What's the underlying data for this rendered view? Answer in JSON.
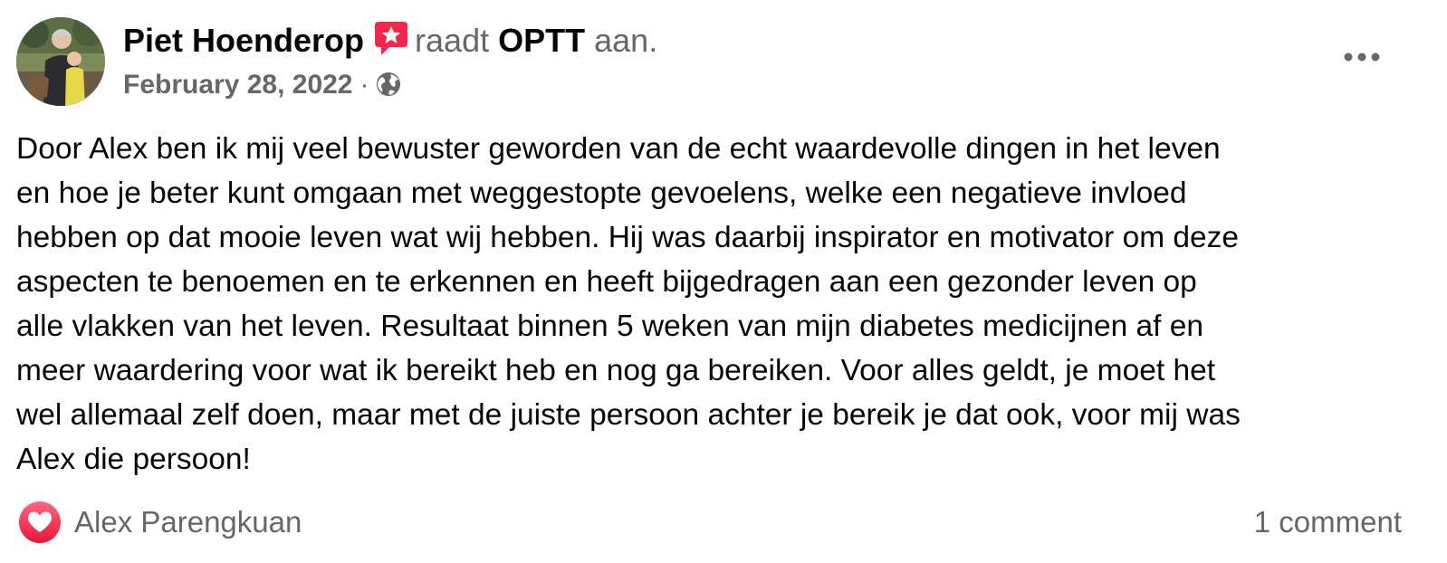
{
  "post": {
    "author": "Piet Hoenderop",
    "recommendation_verb": "raadt",
    "page_name": "OPTT",
    "recommendation_suffix": "aan.",
    "date": "February 28, 2022",
    "separator": "·",
    "audience_icon": "globe-icon",
    "recommend_icon": "recommendation-star-icon",
    "more_icon": "more-options-icon",
    "body": [
      "Door Alex ben ik mij veel bewuster geworden van de echt waardevolle dingen in het leven",
      "en hoe je beter kunt omgaan met weggestopte gevoelens, welke een negatieve invloed",
      "hebben op dat mooie leven wat wij hebben. Hij was daarbij inspirator en motivator om deze",
      "aspecten te benoemen en te erkennen en heeft bijgedragen aan een gezonder leven op",
      "alle vlakken van het leven. Resultaat binnen 5 weken van mijn diabetes medicijnen af en",
      "meer waardering voor wat ik bereikt heb en nog ga bereiken. Voor alles geldt, je moet het",
      "wel allemaal zelf doen, maar met de juiste persoon achter je bereik je dat ook, voor mij was",
      "Alex die persoon!"
    ]
  },
  "footer": {
    "reaction_icon": "love-reaction-icon",
    "reactor": "Alex Parengkuan",
    "comments": "1 comment"
  },
  "colors": {
    "text": "#050505",
    "secondary": "#65676b",
    "love": "#f33e58",
    "recommend": "#f02849"
  }
}
